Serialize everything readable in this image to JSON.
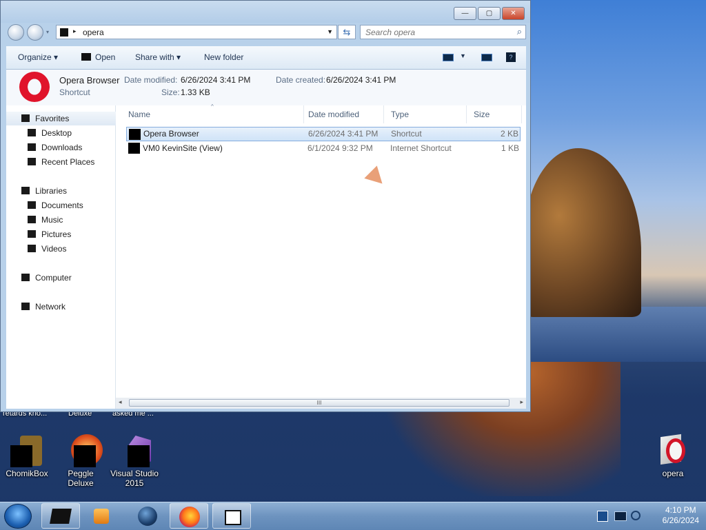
{
  "window": {
    "title_buttons": {
      "minimize": "—",
      "maximize": "▢",
      "close": "✕"
    },
    "address": {
      "path": "opera"
    },
    "search": {
      "placeholder": "Search opera"
    },
    "toolbar": {
      "organize": "Organize ▾",
      "open": "Open",
      "share_with": "Share with ▾",
      "new_folder": "New folder"
    },
    "details": {
      "name": "Opera Browser",
      "type": "Shortcut",
      "date_modified_label": "Date modified:",
      "date_modified": "6/26/2024 3:41 PM",
      "date_created_label": "Date created:",
      "date_created": "6/26/2024 3:41 PM",
      "size_label": "Size:",
      "size": "1.33 KB"
    },
    "nav": {
      "favorites": "Favorites",
      "desktop": "Desktop",
      "downloads": "Downloads",
      "recent_places": "Recent Places",
      "libraries": "Libraries",
      "documents": "Documents",
      "music": "Music",
      "pictures": "Pictures",
      "videos": "Videos",
      "computer": "Computer",
      "network": "Network"
    },
    "columns": {
      "name": "Name",
      "date_modified": "Date modified",
      "type": "Type",
      "size": "Size"
    },
    "files": [
      {
        "name": "Opera Browser",
        "date": "6/26/2024 3:41 PM",
        "type": "Shortcut",
        "size": "2 KB"
      },
      {
        "name": "VM0 KevinSite (View)",
        "date": "6/1/2024 9:32 PM",
        "type": "Internet Shortcut",
        "size": "1 KB"
      }
    ],
    "scroll_grip": "III"
  },
  "desktop": {
    "icons": [
      {
        "label": "ChomikBox"
      },
      {
        "label": "Peggle Deluxe"
      },
      {
        "label": "Visual Studio 2015"
      },
      {
        "label": "opera"
      }
    ],
    "cut_labels": [
      "retards kno...",
      "Deluxe",
      "asked me ..."
    ]
  },
  "taskbar": {
    "time": "4:10 PM",
    "date": "6/26/2024"
  }
}
